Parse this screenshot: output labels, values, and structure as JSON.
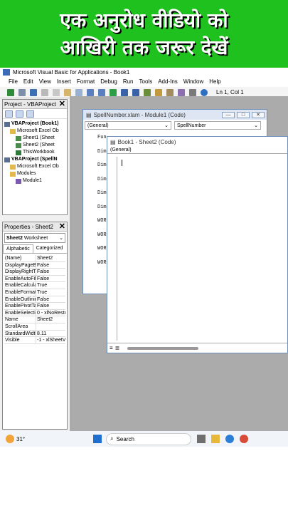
{
  "banner": {
    "line1": "एक अनुरोध वीडियो को",
    "line2": "आखिरी तक जरूर देखें"
  },
  "app": {
    "title": "Microsoft Visual Basic for Applications - Book1"
  },
  "menu": [
    "File",
    "Edit",
    "View",
    "Insert",
    "Format",
    "Debug",
    "Run",
    "Tools",
    "Add-Ins",
    "Window",
    "Help"
  ],
  "toolbar": {
    "status": "Ln 1, Col 1"
  },
  "project": {
    "title": "Project - VBAProject",
    "tree": [
      {
        "label": "VBAProject (Book1)",
        "indent": 0,
        "icon": "vba-project-icon"
      },
      {
        "label": "Microsoft Excel Ob",
        "indent": 1,
        "icon": "folder-icon"
      },
      {
        "label": "Sheet1 (Sheet",
        "indent": 2,
        "icon": "sheet-icon"
      },
      {
        "label": "Sheet2 (Sheet",
        "indent": 2,
        "icon": "sheet-icon"
      },
      {
        "label": "ThisWorkbook",
        "indent": 2,
        "icon": "workbook-icon"
      },
      {
        "label": "VBAProject (SpellN",
        "indent": 0,
        "icon": "vba-project-icon"
      },
      {
        "label": "Microsoft Excel Ob",
        "indent": 1,
        "icon": "folder-icon"
      },
      {
        "label": "Modules",
        "indent": 1,
        "icon": "folder-icon"
      },
      {
        "label": "Module1",
        "indent": 2,
        "icon": "module-icon"
      }
    ]
  },
  "properties": {
    "title": "Properties - Sheet2",
    "object": "Sheet2",
    "object_type": "Worksheet",
    "tabs": [
      "Alphabetic",
      "Categorized"
    ],
    "rows": [
      [
        "(Name)",
        "Sheet2"
      ],
      [
        "DisplayPageBrea",
        "False"
      ],
      [
        "DisplayRightToL",
        "False"
      ],
      [
        "EnableAutoFilte",
        "False"
      ],
      [
        "EnableCalculati",
        "True"
      ],
      [
        "EnableFormatCo",
        "True"
      ],
      [
        "EnableOutlining",
        "False"
      ],
      [
        "EnablePivotTabl",
        "False"
      ],
      [
        "EnableSelection",
        "0 - xlNoRestri"
      ],
      [
        "Name",
        "Sheet2"
      ],
      [
        "ScrollArea",
        ""
      ],
      [
        "StandardWidth",
        "8.11"
      ],
      [
        "Visible",
        "-1 - xlSheetVi"
      ]
    ]
  },
  "spellwin": {
    "title": "SpellNumber.xlam - Module1 (Code)",
    "object": "(General)",
    "proc": "SpellNumber",
    "lines": [
      "Fun",
      "Dim",
      "Dim",
      "Dim",
      "Dim",
      "Dim",
      "WOR",
      "WOR",
      "WOR",
      "WOR"
    ]
  },
  "sheetwin": {
    "title": "Book1 - Sheet2 (Code)",
    "object": "(General)"
  },
  "taskbar": {
    "weather": "31°",
    "search_placeholder": "Search"
  }
}
